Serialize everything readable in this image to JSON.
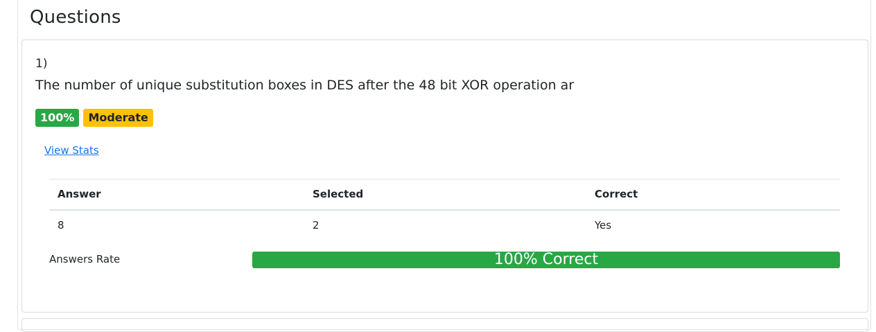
{
  "page": {
    "heading": "Questions"
  },
  "question": {
    "number": "1)",
    "text": "The number of unique substitution boxes in DES after the 48 bit XOR operation ar",
    "badges": {
      "percent": "100%",
      "difficulty": "Moderate"
    },
    "view_stats_link": "View Stats"
  },
  "stats_table": {
    "headers": [
      "Answer",
      "Selected",
      "Correct"
    ],
    "rows": [
      [
        "8",
        "2",
        "Yes"
      ]
    ]
  },
  "answers_rate": {
    "label": "Answers Rate",
    "progress_text": "100% Correct",
    "progress_percent": 100
  },
  "colors": {
    "success": "#28a745",
    "warning": "#ffc107",
    "link": "#1a73e8"
  }
}
